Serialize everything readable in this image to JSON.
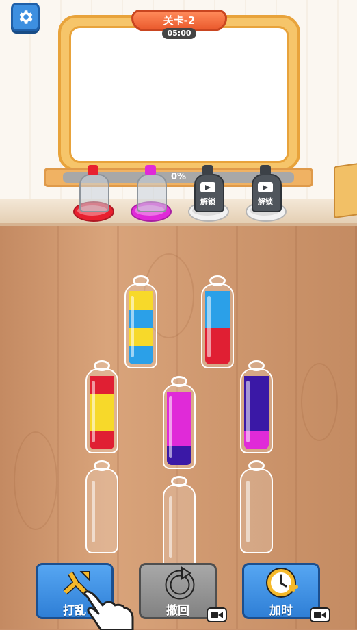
{
  "header": {
    "level_title": "关卡-2",
    "timer": "05:00"
  },
  "progress": {
    "value_percent": 0,
    "label": "0%"
  },
  "caps": [
    {
      "color": "#e8202f",
      "locked": false,
      "lock_label": ""
    },
    {
      "color": "#e02ad8",
      "locked": false,
      "lock_label": ""
    },
    {
      "color": "#555a60",
      "locked": true,
      "lock_label": "解锁"
    },
    {
      "color": "#555a60",
      "locked": true,
      "lock_label": "解锁"
    }
  ],
  "bottles": [
    {
      "layers_bottom_to_top": [
        "#2ba0e8",
        "#f7d92a",
        "#2ba0e8",
        "#f7d92a"
      ],
      "fill_fraction": 0.92
    },
    {
      "layers_bottom_to_top": [
        "#e01f33",
        "#e01f33",
        "#2ba0e8",
        "#2ba0e8"
      ],
      "fill_fraction": 0.92
    },
    {
      "layers_bottom_to_top": [
        "#e01f33",
        "#f7d92a",
        "#f7d92a",
        "#e01f33"
      ],
      "fill_fraction": 0.92
    },
    {
      "layers_bottom_to_top": [
        "#3a18a6",
        "#e02ad8",
        "#e02ad8",
        "#e02ad8"
      ],
      "fill_fraction": 0.92
    },
    {
      "layers_bottom_to_top": [
        "#e02ad8",
        "#3a18a6",
        "#3a18a6",
        "#3a18a6"
      ],
      "fill_fraction": 0.92
    },
    {
      "layers_bottom_to_top": [],
      "fill_fraction": 0
    },
    {
      "layers_bottom_to_top": [],
      "fill_fraction": 0
    },
    {
      "layers_bottom_to_top": [],
      "fill_fraction": 0
    }
  ],
  "buttons": {
    "shuffle_label": "打乱",
    "undo_label": "撤回",
    "add_time_label": "加时"
  },
  "icons": {
    "settings": "gear-icon",
    "shuffle": "shuffle-arrows-icon",
    "undo": "undo-arrow-icon",
    "add_time": "clock-plus-icon",
    "video": "video-ad-icon",
    "hand": "pointing-hand-icon"
  },
  "colors": {
    "blue_button": "#3d8fe0",
    "gray_button": "#8c8c8c",
    "banner": "#ea5a2d"
  }
}
